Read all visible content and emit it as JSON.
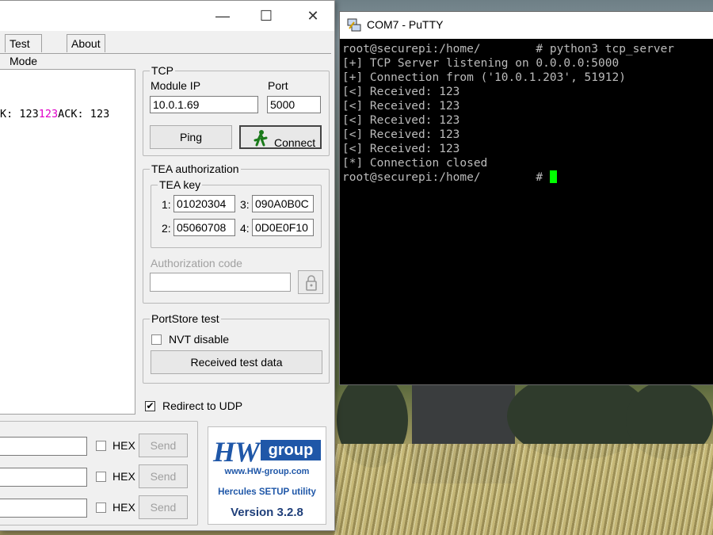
{
  "hercules": {
    "tabs": [
      "Test Mode",
      "About"
    ],
    "receive_text": "K: 123",
    "receive_highlight": "123",
    "receive_tail": "ACK: 123",
    "tcp": {
      "legend": "TCP",
      "module_ip_label": "Module IP",
      "module_ip": "10.0.1.69",
      "port_label": "Port",
      "port": "5000",
      "ping_label": "Ping",
      "connect_label": "Connect"
    },
    "tea": {
      "legend": "TEA authorization",
      "key_legend": "TEA key",
      "keys": [
        {
          "num": "1:",
          "value": "01020304"
        },
        {
          "num": "2:",
          "value": "05060708"
        },
        {
          "num": "3:",
          "value": "090A0B0C"
        },
        {
          "num": "4:",
          "value": "0D0E0F10"
        }
      ],
      "auth_code_label": "Authorization code",
      "auth_code": ""
    },
    "portstore": {
      "legend": "PortStore test",
      "nvt_label": "NVT disable",
      "received_btn": "Received test data"
    },
    "redirect_label": "Redirect to UDP",
    "send_rows": [
      {
        "hex_label": "HEX",
        "send_label": "Send"
      },
      {
        "hex_label": "HEX",
        "send_label": "Send"
      },
      {
        "hex_label": "HEX",
        "send_label": "Send"
      }
    ],
    "logo": {
      "hw": "HW",
      "group": "group",
      "url": "www.HW-group.com",
      "utility": "Hercules SETUP utility",
      "version": "Version  3.2.8"
    },
    "window_controls": [
      "—",
      "☐",
      "✕"
    ]
  },
  "putty": {
    "title": "COM7 - PuTTY",
    "lines": [
      "root@securepi:/home/        # python3 tcp_server",
      "[+] TCP Server listening on 0.0.0.0:5000",
      "[+] Connection from ('10.0.1.203', 51912)",
      "[<] Received: 123",
      "[<] Received: 123",
      "[<] Received: 123",
      "[<] Received: 123",
      "[<] Received: 123",
      "[*] Connection closed",
      "root@securepi:/home/        # "
    ]
  },
  "colors": {
    "accent_blue": "#1f57a8",
    "cursor_green": "#00ff00",
    "highlight_magenta": "#e000c8"
  }
}
